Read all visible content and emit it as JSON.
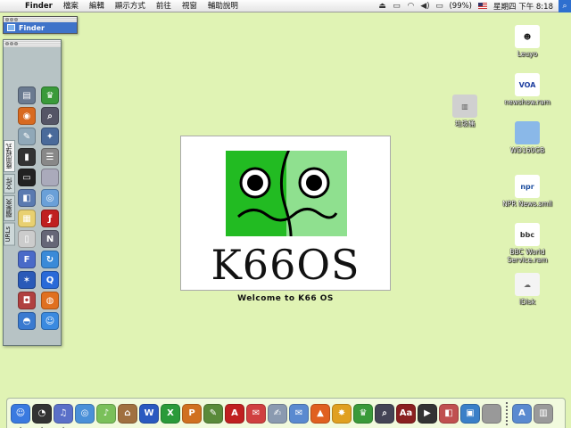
{
  "menubar": {
    "apple_icon": "apple-icon",
    "app_name": "Finder",
    "menus": [
      "檔案",
      "編輯",
      "顯示方式",
      "前往",
      "視窗",
      "輔助說明"
    ],
    "battery": "(99%)",
    "clock": "星期四 下午 8:18",
    "status_icons": [
      "eject-icon",
      "display-icon",
      "airport-icon",
      "volume-icon",
      "battery-icon"
    ]
  },
  "finder_window": {
    "title": "Finder"
  },
  "drawer": {
    "tabs": [
      "應用程式",
      "文件",
      "檔案夾",
      "URLs"
    ],
    "items": [
      {
        "icon": "disk-utility-icon",
        "glyph": "▤",
        "color": "#6a7a90"
      },
      {
        "icon": "chess-icon",
        "glyph": "♛",
        "color": "#3a9a3a"
      },
      {
        "icon": "firefox-icon",
        "glyph": "◉",
        "color": "#d86a20"
      },
      {
        "icon": "preview-icon",
        "glyph": "⌕",
        "color": "#556"
      },
      {
        "icon": "stickies-icon",
        "glyph": "✎",
        "color": "#90a8b8"
      },
      {
        "icon": "directory-icon",
        "glyph": "✦",
        "color": "#4a6a9a"
      },
      {
        "icon": "activity-monitor-icon",
        "glyph": "▮",
        "color": "#333"
      },
      {
        "icon": "ichat-icon",
        "glyph": "☰",
        "color": "#888"
      },
      {
        "icon": "terminal-icon",
        "glyph": "▭",
        "color": "#222"
      },
      {
        "icon": "apple-system-icon",
        "glyph": "",
        "color": "#aab"
      },
      {
        "icon": "network-icon",
        "glyph": "◧",
        "color": "#5a7ab0"
      },
      {
        "icon": "safari-icon",
        "glyph": "◎",
        "color": "#6aa0d8"
      },
      {
        "icon": "notes-icon",
        "glyph": "▦",
        "color": "#e8d070"
      },
      {
        "icon": "flash-icon",
        "glyph": "ƒ",
        "color": "#c02020"
      },
      {
        "icon": "ipod-icon",
        "glyph": "▯",
        "color": "#ccc"
      },
      {
        "icon": "nero-icon",
        "glyph": "N",
        "color": "#667"
      },
      {
        "icon": "font-book-icon",
        "glyph": "F",
        "color": "#4a6ac8"
      },
      {
        "icon": "sync-icon",
        "glyph": "↻",
        "color": "#3a8ad8"
      },
      {
        "icon": "imovie-icon",
        "glyph": "✶",
        "color": "#2a5ab8"
      },
      {
        "icon": "quicktime-icon",
        "glyph": "Q",
        "color": "#2a6ad8"
      },
      {
        "icon": "photo-booth-icon",
        "glyph": "◘",
        "color": "#b04040"
      },
      {
        "icon": "ical-icon",
        "glyph": "◍",
        "color": "#e07020"
      },
      {
        "icon": "globe-icon",
        "glyph": "◓",
        "color": "#3a7ad0"
      },
      {
        "icon": "finder-face-icon",
        "glyph": "☺",
        "color": "#3a8ae0"
      }
    ]
  },
  "welcome": {
    "brand": "K66OS",
    "caption": "Welcome to K66 OS",
    "logo_colors": {
      "left": "#22bb22",
      "right": "#8fe08f",
      "line": "#000000"
    }
  },
  "desktop_icons": [
    {
      "name": "desktop-icon-leuyo",
      "label": "Leuyo",
      "glyph": "☻",
      "bg": "#ffffff",
      "fg": "#111"
    },
    {
      "name": "desktop-icon-newshow",
      "label": "newshow.ram",
      "glyph": "VOA",
      "bg": "#ffffff",
      "fg": "#2040a0"
    },
    {
      "name": "desktop-icon-trash",
      "label": "垃圾桶",
      "glyph": "▥",
      "bg": "#d0d0d0",
      "fg": "#555"
    },
    {
      "name": "desktop-icon-wd160gb",
      "label": "WD160GB",
      "glyph": "",
      "bg": "#8ab8e8",
      "fg": "#fff"
    },
    {
      "name": "desktop-icon-npr",
      "label": "NPR News.smil",
      "glyph": "npr",
      "bg": "#ffffff",
      "fg": "#2050a0"
    },
    {
      "name": "desktop-icon-bbc",
      "label": "BBC World Service.ram",
      "glyph": "bbc",
      "bg": "#ffffff",
      "fg": "#333"
    },
    {
      "name": "desktop-icon-idisk",
      "label": "iDisk",
      "glyph": "☁",
      "bg": "#f4f4f4",
      "fg": "#666"
    }
  ],
  "dock": {
    "items": [
      {
        "icon": "finder-icon",
        "glyph": "☺",
        "color": "#3a7ae0",
        "running": true
      },
      {
        "icon": "dashboard-icon",
        "glyph": "◔",
        "color": "#333",
        "running": true
      },
      {
        "icon": "itunes-icon",
        "glyph": "♫",
        "color": "#5a70c8",
        "running": true
      },
      {
        "icon": "safari-icon",
        "glyph": "◎",
        "color": "#4a90d8",
        "running": false
      },
      {
        "icon": "itunes-music-icon",
        "glyph": "♪",
        "color": "#7ac05a",
        "running": false
      },
      {
        "icon": "home-icon",
        "glyph": "⌂",
        "color": "#a07040",
        "running": false
      },
      {
        "icon": "word-icon",
        "glyph": "W",
        "color": "#2a5ac0",
        "running": false
      },
      {
        "icon": "excel-icon",
        "glyph": "X",
        "color": "#2a9a3a",
        "running": false
      },
      {
        "icon": "powerpoint-icon",
        "glyph": "P",
        "color": "#d07020",
        "running": false
      },
      {
        "icon": "pencil-icon",
        "glyph": "✎",
        "color": "#5a8a3a",
        "running": false
      },
      {
        "icon": "acrobat-icon",
        "glyph": "A",
        "color": "#c02020",
        "running": false
      },
      {
        "icon": "pdf-icon",
        "glyph": "✉",
        "color": "#d04040",
        "running": false
      },
      {
        "icon": "text-icon",
        "glyph": "✍",
        "color": "#8a9ab0",
        "running": false
      },
      {
        "icon": "mail-icon",
        "glyph": "✉",
        "color": "#5a8ad0",
        "running": false
      },
      {
        "icon": "matlab-icon",
        "glyph": "▲",
        "color": "#e06020",
        "running": false
      },
      {
        "icon": "star-icon",
        "glyph": "✸",
        "color": "#e0a020",
        "running": false
      },
      {
        "icon": "chess-icon",
        "glyph": "♛",
        "color": "#3a9a3a",
        "running": false
      },
      {
        "icon": "preview-icon",
        "glyph": "⌕",
        "color": "#445",
        "running": false
      },
      {
        "icon": "dictionary-icon",
        "glyph": "Aa",
        "color": "#8a2020",
        "running": false
      },
      {
        "icon": "dvd-player-icon",
        "glyph": "▶",
        "color": "#333",
        "running": false
      },
      {
        "icon": "photo-icon",
        "glyph": "◧",
        "color": "#c05050",
        "running": false
      },
      {
        "icon": "image-capture-icon",
        "glyph": "▣",
        "color": "#3a80c8",
        "running": false
      },
      {
        "icon": "apple-system-icon",
        "glyph": "",
        "color": "#999",
        "running": false
      }
    ],
    "trailing": [
      {
        "icon": "applications-folder-icon",
        "glyph": "A",
        "color": "#5a8ad0",
        "running": false
      },
      {
        "icon": "trash-icon",
        "glyph": "▥",
        "color": "#9a9a9a",
        "running": false
      }
    ]
  }
}
